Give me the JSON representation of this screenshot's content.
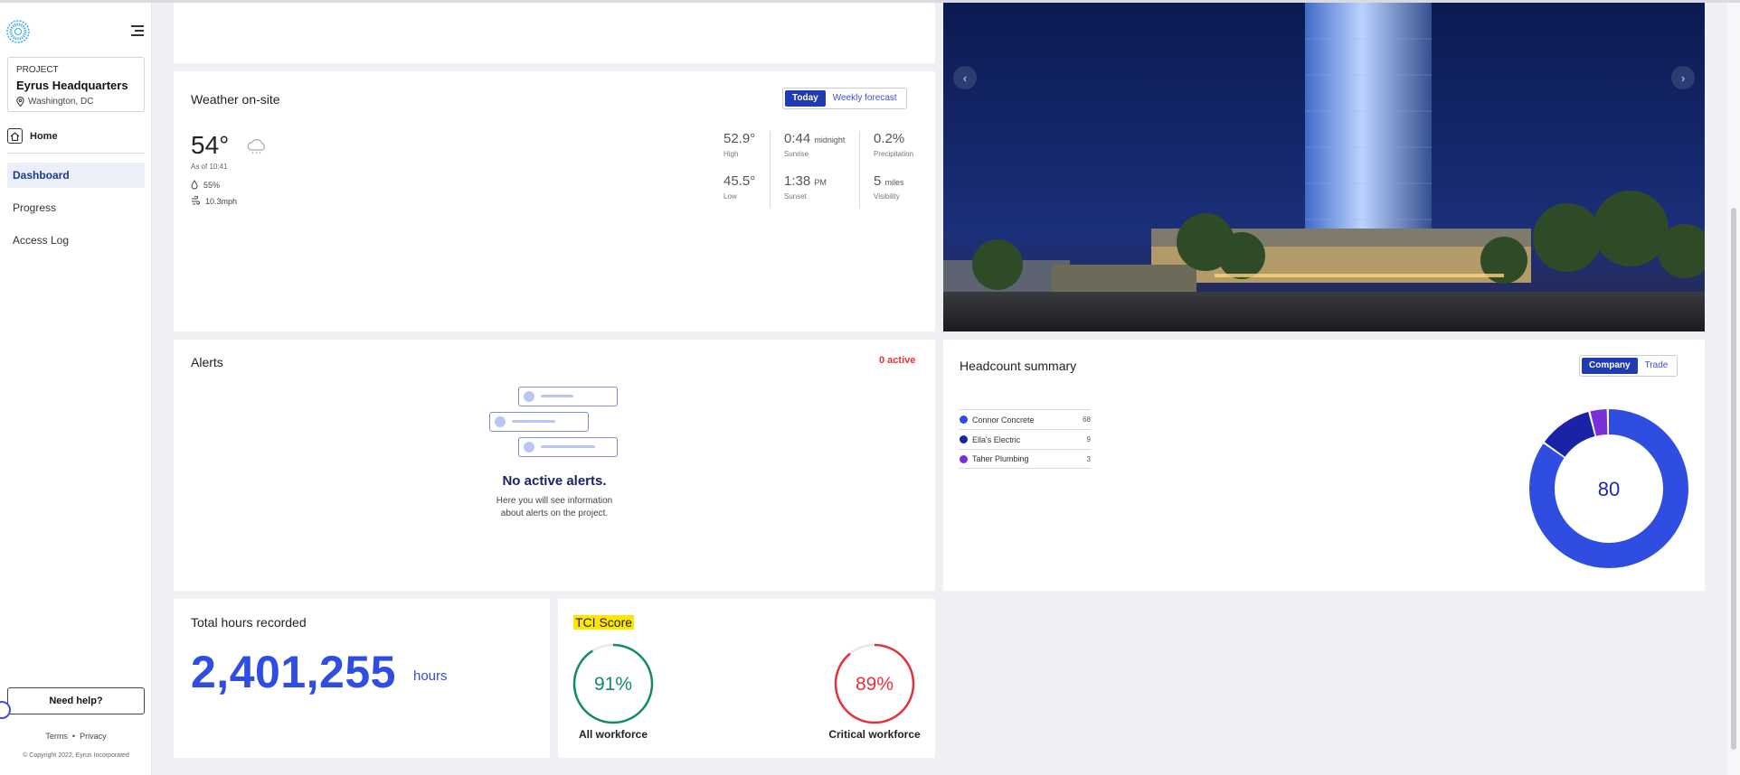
{
  "sidebar": {
    "project_label": "PROJECT",
    "project_name": "Eyrus Headquarters",
    "project_location": "Washington, DC",
    "home_label": "Home",
    "nav_items": [
      {
        "label": "Dashboard",
        "active": true
      },
      {
        "label": "Progress",
        "active": false
      },
      {
        "label": "Access Log",
        "active": false
      }
    ],
    "help_label": "Need help?",
    "terms_label": "Terms",
    "privacy_label": "Privacy",
    "separator": "•",
    "copyright": "© Copyright 2022, Eyrus Incorporated"
  },
  "weather": {
    "title": "Weather on-site",
    "toggle": {
      "today": "Today",
      "weekly": "Weekly forecast"
    },
    "temperature": "54°",
    "as_of": "As of 10:41",
    "humidity": "55%",
    "wind": "10.3mph",
    "icon": "cloud-icon",
    "stats": {
      "high": {
        "value": "52.9°",
        "label": "High"
      },
      "low": {
        "value": "45.5°",
        "label": "Low"
      },
      "sunrise": {
        "value": "0:44",
        "unit": "midnight",
        "label": "Sunrise"
      },
      "sunset": {
        "value": "1:38",
        "unit": "PM",
        "label": "Sunset"
      },
      "precipitation": {
        "value": "0.2%",
        "label": "Precipitation"
      },
      "visibility": {
        "value": "5",
        "unit": "miles",
        "label": "Visibility"
      }
    }
  },
  "alerts": {
    "title": "Alerts",
    "count_label": "0 active",
    "empty_title": "No active alerts.",
    "empty_line1": "Here you will see information",
    "empty_line2": "about alerts on the project."
  },
  "headcount": {
    "title": "Headcount summary",
    "toggle": {
      "company": "Company",
      "trade": "Trade"
    },
    "total": "80",
    "companies": [
      {
        "name": "Connor Concrete",
        "count": "68",
        "color": "#2f4de0"
      },
      {
        "name": "Ella's Electric",
        "count": "9",
        "color": "#1a22a6"
      },
      {
        "name": "Taher Plumbing",
        "count": "3",
        "color": "#7b2fd8"
      }
    ]
  },
  "hours": {
    "title": "Total hours recorded",
    "value": "2,401,255",
    "unit": "hours"
  },
  "tci": {
    "title": "TCI Score",
    "all": {
      "value": "91%",
      "percent": 91,
      "label": "All workforce",
      "color": "#138a6e"
    },
    "critical": {
      "value": "89%",
      "percent": 89,
      "label": "Critical workforce",
      "color": "#e5323a"
    }
  },
  "colors": {
    "accent": "#2f4de0",
    "active_nav_bg": "#eceff7",
    "alert_red": "#e5323a"
  }
}
